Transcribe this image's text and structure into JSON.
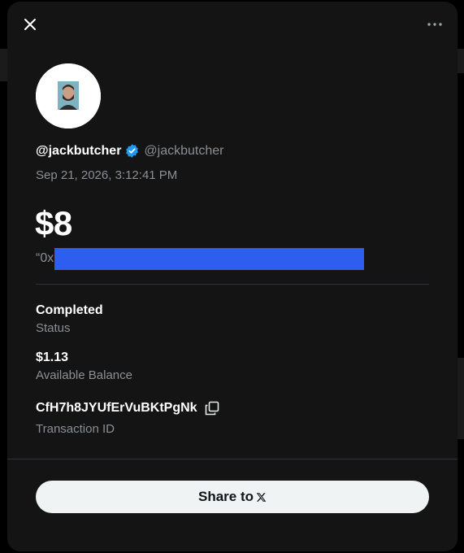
{
  "header": {
    "close_icon": "close-icon",
    "more_icon": "more-icon"
  },
  "user": {
    "display_name": "@jackbutcher",
    "handle": "@jackbutcher",
    "verified": true
  },
  "transaction": {
    "timestamp": "Sep 21, 2026, 3:12:41 PM",
    "amount": "$8",
    "memo_prefix": "“0x",
    "status_value": "Completed",
    "status_label": "Status",
    "balance_value": "$1.13",
    "balance_label": "Available Balance",
    "txid_value": "CfH7h8JYUfErVuBKtPgNk",
    "txid_label": "Transaction ID"
  },
  "share": {
    "label": "Share to",
    "logo": "x-logo-icon"
  },
  "colors": {
    "modal_bg": "#141414",
    "accent_blue": "#1d9bf0",
    "redaction": "#2d5ef0",
    "button_bg": "#eff3f4"
  }
}
